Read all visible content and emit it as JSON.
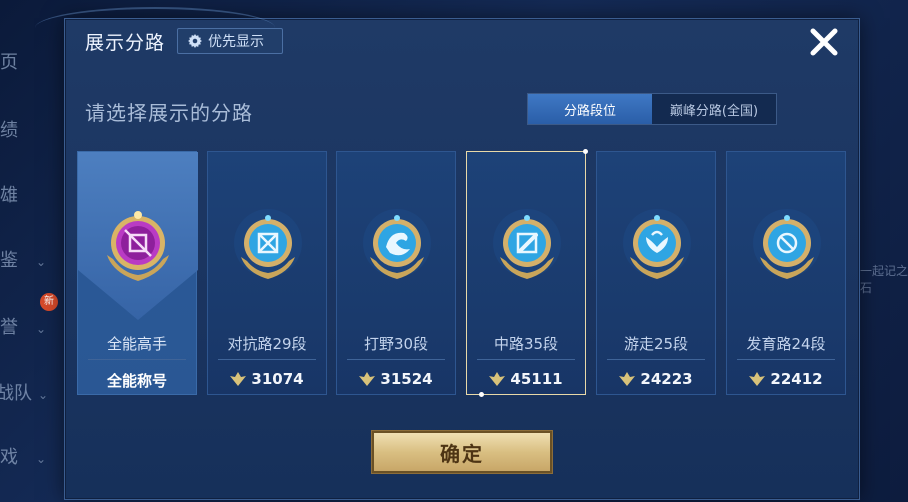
{
  "background_menu": {
    "items": [
      {
        "label": "页",
        "has_chevron": false
      },
      {
        "label": "绩",
        "has_chevron": false
      },
      {
        "label": "雄",
        "has_chevron": false
      },
      {
        "label": "鉴",
        "has_chevron": true
      },
      {
        "label": "誉",
        "has_chevron": true
      },
      {
        "label": "战队",
        "has_chevron": true
      },
      {
        "label": "戏",
        "has_chevron": true
      }
    ],
    "badge": "新",
    "right_text": "一起记之石"
  },
  "dialog": {
    "title": "展示分路",
    "priority_button": "优先显示",
    "subtitle": "请选择展示的分路",
    "tabs": [
      {
        "label": "分路段位",
        "active": true
      },
      {
        "label": "巅峰分路(全国)",
        "active": false
      }
    ],
    "cards": [
      {
        "name": "全能高手",
        "score": "",
        "title": "全能称号",
        "icon": "all-rounder-emblem-icon",
        "selected": false,
        "special": true
      },
      {
        "name": "对抗路29段",
        "score": "31074",
        "icon": "clash-lane-emblem-icon",
        "selected": false,
        "special": false
      },
      {
        "name": "打野30段",
        "score": "31524",
        "icon": "jungle-emblem-icon",
        "selected": false,
        "special": false
      },
      {
        "name": "中路35段",
        "score": "45111",
        "icon": "mid-lane-emblem-icon",
        "selected": true,
        "special": false
      },
      {
        "name": "游走25段",
        "score": "24223",
        "icon": "roam-emblem-icon",
        "selected": false,
        "special": false
      },
      {
        "name": "发育路24段",
        "score": "22412",
        "icon": "farm-lane-emblem-icon",
        "selected": false,
        "special": false
      }
    ],
    "confirm_button": "确定"
  },
  "colors": {
    "accent_blue": "#2a5ea8",
    "gold": "#d9bf82",
    "selected_border": "#e8d9a8",
    "special_emblem": "#b93bc4"
  }
}
